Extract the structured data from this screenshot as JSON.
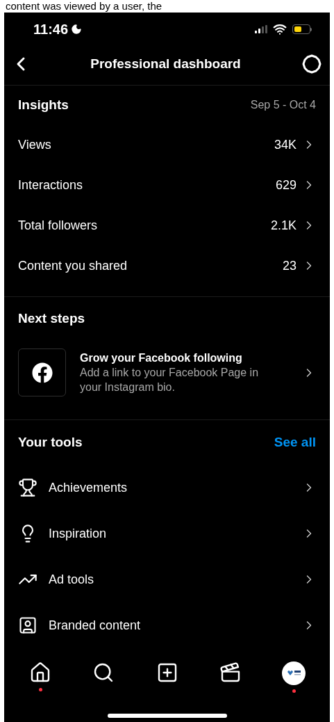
{
  "page_above": {
    "text": "content was viewed by a user, the"
  },
  "status_bar": {
    "time": "11:46"
  },
  "header": {
    "title": "Professional dashboard"
  },
  "insights": {
    "title": "Insights",
    "date_range": "Sep 5 - Oct 4",
    "rows": [
      {
        "label": "Views",
        "value": "34K"
      },
      {
        "label": "Interactions",
        "value": "629"
      },
      {
        "label": "Total followers",
        "value": "2.1K"
      },
      {
        "label": "Content you shared",
        "value": "23"
      }
    ]
  },
  "next_steps": {
    "title": "Next steps",
    "card": {
      "title": "Grow your Facebook following",
      "description": "Add a link to your Facebook Page in your Instagram bio."
    }
  },
  "tools": {
    "title": "Your tools",
    "link": "See all",
    "items": [
      {
        "kind": "trophy",
        "label": "Achievements"
      },
      {
        "kind": "bulb",
        "label": "Inspiration"
      },
      {
        "kind": "trend",
        "label": "Ad tools"
      },
      {
        "kind": "badge",
        "label": "Branded content"
      }
    ]
  },
  "nav": [
    {
      "kind": "home",
      "dot": true
    },
    {
      "kind": "search",
      "dot": false
    },
    {
      "kind": "create",
      "dot": false
    },
    {
      "kind": "reels",
      "dot": false
    },
    {
      "kind": "profile",
      "dot": true
    }
  ]
}
